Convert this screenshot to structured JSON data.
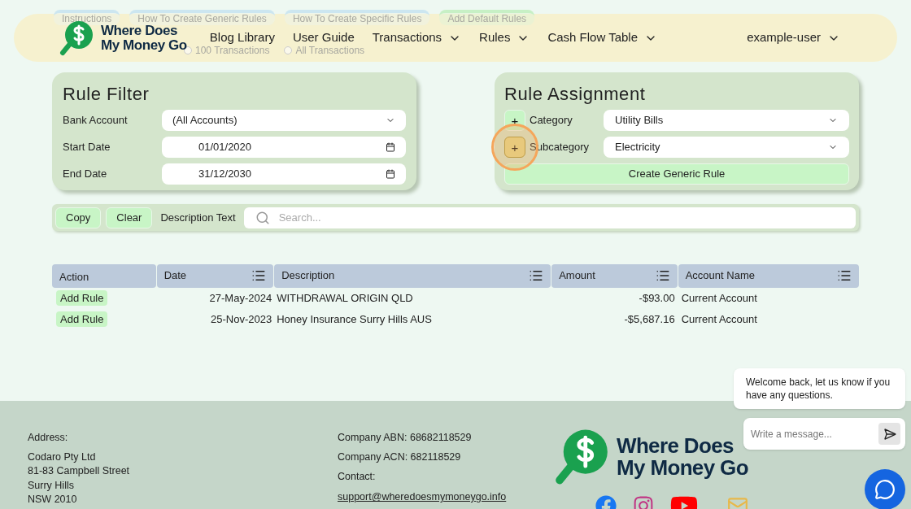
{
  "background_tabs": [
    {
      "label": "Instructions",
      "kind": "info"
    },
    {
      "label": "How To Create Generic Rules",
      "kind": "info"
    },
    {
      "label": "How To Create Specific Rules",
      "kind": "info"
    },
    {
      "label": "Add Default Rules",
      "kind": "action"
    }
  ],
  "background_options": [
    {
      "label": "100 Transactions",
      "selected": false
    },
    {
      "label": "All Transactions",
      "selected": false
    }
  ],
  "header": {
    "logo_line_1": "Where Does",
    "logo_line_2": "My Money Go",
    "nav": [
      {
        "label": "Blog Library",
        "dropdown": false
      },
      {
        "label": "User Guide",
        "dropdown": false
      },
      {
        "label": "Transactions",
        "dropdown": true
      },
      {
        "label": "Rules",
        "dropdown": true
      },
      {
        "label": "Cash Flow Table",
        "dropdown": true
      }
    ],
    "user": "example-user"
  },
  "rule_filter": {
    "title": "Rule Filter",
    "fields": [
      {
        "label": "Bank Account",
        "value": "(All Accounts)",
        "kind": "select"
      },
      {
        "label": "Start Date",
        "value": "01/01/2020",
        "kind": "date"
      },
      {
        "label": "End Date",
        "value": "31/12/2030",
        "kind": "date"
      }
    ]
  },
  "rule_assignment": {
    "title": "Rule Assignment",
    "fields": [
      {
        "label": "Category",
        "add": "+",
        "value": "Utility Bills",
        "highlighted": false
      },
      {
        "label": "Subcategory",
        "add": "+",
        "value": "Electricity",
        "highlighted": true
      }
    ],
    "button": "Create Generic Rule"
  },
  "toolbar": {
    "buttons": [
      "Copy",
      "Clear"
    ],
    "label": "Description Text",
    "placeholder": "Search..."
  },
  "table": {
    "columns": [
      {
        "label": "Action",
        "menu": false
      },
      {
        "label": "Date",
        "menu": true
      },
      {
        "label": "Description",
        "menu": true
      },
      {
        "label": "Amount",
        "menu": true
      },
      {
        "label": "Account Name",
        "menu": true
      }
    ],
    "rows": [
      {
        "action": "Add Rule",
        "date": "27-May-2024",
        "description": "WITHDRAWAL ORIGIN QLD",
        "amount": "-$93.00",
        "account": "Current Account"
      },
      {
        "action": "Add Rule",
        "date": "25-Nov-2023",
        "description": "Honey Insurance Surry Hills AUS",
        "amount": "-$5,687.16",
        "account": "Current Account"
      }
    ]
  },
  "footer": {
    "address_label": "Address:",
    "address": [
      "Codaro Pty Ltd",
      "81-83 Campbell Street",
      "Surry Hills",
      "NSW 2010"
    ],
    "company": [
      "Company ABN: 68682118529",
      "Company ACN: 682118529",
      "Contact:"
    ],
    "email": "support@wheredoesmymoneygo.info",
    "logo_line_1": "Where Does",
    "logo_line_2": "My Money Go"
  },
  "chat": {
    "message": "Welcome back, let us know if you have any questions.",
    "placeholder": "Write a message..."
  }
}
